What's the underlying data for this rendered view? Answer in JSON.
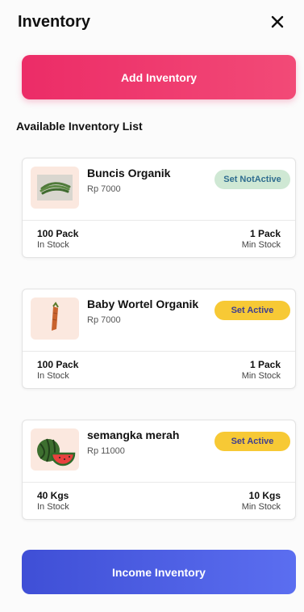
{
  "header": {
    "title": "Inventory",
    "close_icon": "close-icon"
  },
  "actions": {
    "add_label": "Add Inventory",
    "income_label": "Income Inventory"
  },
  "list": {
    "title": "Available Inventory List",
    "items": [
      {
        "name": "Buncis Organik",
        "price": "Rp 7000",
        "image": "green-beans-image",
        "badge": "Set NotActive",
        "stock_value": "100 Pack",
        "stock_label": "In Stock",
        "min_value": "1 Pack",
        "min_label": "Min Stock"
      },
      {
        "name": "Baby Wortel Organik",
        "price": "Rp 7000",
        "image": "baby-carrot-image",
        "badge": "Set Active",
        "stock_value": "100 Pack",
        "stock_label": "In Stock",
        "min_value": "1 Pack",
        "min_label": "Min Stock"
      },
      {
        "name": "semangka merah",
        "price": "Rp 11000",
        "image": "watermelon-image",
        "badge": "Set Active",
        "stock_value": "40 Kgs",
        "stock_label": "In Stock",
        "min_value": "10 Kgs",
        "min_label": "Min Stock"
      }
    ]
  },
  "colors": {
    "primary_pink": "#ec2c67",
    "primary_blue": "#4a5ce6",
    "badge_active": "#f7c935",
    "badge_notactive": "#cfe8d4",
    "thumb_bg": "#fbe8df"
  }
}
